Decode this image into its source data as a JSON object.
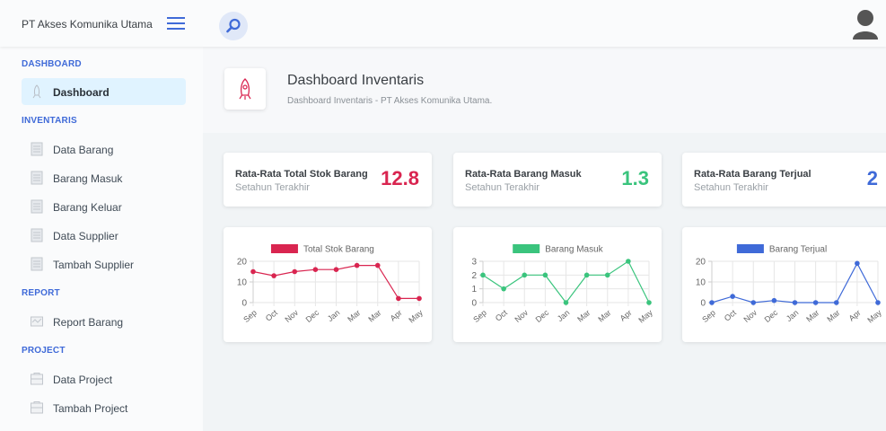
{
  "header": {
    "brand": "PT Akses Komunika Utama"
  },
  "sidebar": {
    "sections": [
      {
        "title": "DASHBOARD",
        "items": [
          {
            "label": "Dashboard"
          }
        ]
      },
      {
        "title": "INVENTARIS",
        "items": [
          {
            "label": "Data Barang"
          },
          {
            "label": "Barang Masuk"
          },
          {
            "label": "Barang Keluar"
          },
          {
            "label": "Data Supplier"
          },
          {
            "label": "Tambah Supplier"
          }
        ]
      },
      {
        "title": "REPORT",
        "items": [
          {
            "label": "Report Barang"
          }
        ]
      },
      {
        "title": "PROJECT",
        "items": [
          {
            "label": "Data Project"
          },
          {
            "label": "Tambah Project"
          }
        ]
      }
    ]
  },
  "page": {
    "title": "Dashboard Inventaris",
    "subtitle": "Dashboard Inventaris - PT Akses Komunika Utama."
  },
  "stats": [
    {
      "title": "Rata-Rata Total Stok Barang",
      "subtitle": "Setahun Terakhir",
      "value": "12.8",
      "color": "#d92550"
    },
    {
      "title": "Rata-Rata Barang Masuk",
      "subtitle": "Setahun Terakhir",
      "value": "1.3",
      "color": "#3ac47d"
    },
    {
      "title": "Rata-Rata Barang Terjual",
      "subtitle": "Setahun Terakhir",
      "value": "2",
      "color": "#3f6ad8"
    }
  ],
  "chart_data": [
    {
      "type": "line",
      "categories": [
        "Sep",
        "Oct",
        "Nov",
        "Dec",
        "Jan",
        "Mar",
        "Mar",
        "Apr",
        "May"
      ],
      "series": [
        {
          "name": "Total Stok Barang",
          "values": [
            15,
            13,
            15,
            16,
            16,
            18,
            18,
            2,
            2
          ],
          "color": "#d92550"
        }
      ],
      "yticks": [
        0,
        10,
        20
      ],
      "ylim": [
        0,
        20
      ],
      "grid": true,
      "legend": "top"
    },
    {
      "type": "line",
      "categories": [
        "Sep",
        "Oct",
        "Nov",
        "Dec",
        "Jan",
        "Mar",
        "Mar",
        "Apr",
        "May"
      ],
      "series": [
        {
          "name": "Barang Masuk",
          "values": [
            2,
            1,
            2,
            2,
            0,
            2,
            2,
            3,
            0
          ],
          "color": "#3ac47d"
        }
      ],
      "yticks": [
        0,
        1,
        2,
        3
      ],
      "ylim": [
        0,
        3
      ],
      "grid": true,
      "legend": "top"
    },
    {
      "type": "line",
      "categories": [
        "Sep",
        "Oct",
        "Nov",
        "Dec",
        "Jan",
        "Mar",
        "Mar",
        "Apr",
        "May"
      ],
      "series": [
        {
          "name": "Barang Terjual",
          "values": [
            0,
            3,
            0,
            1,
            0,
            0,
            0,
            19,
            0
          ],
          "color": "#3f6ad8"
        }
      ],
      "yticks": [
        0,
        10,
        20
      ],
      "ylim": [
        0,
        20
      ],
      "grid": true,
      "legend": "top"
    }
  ]
}
